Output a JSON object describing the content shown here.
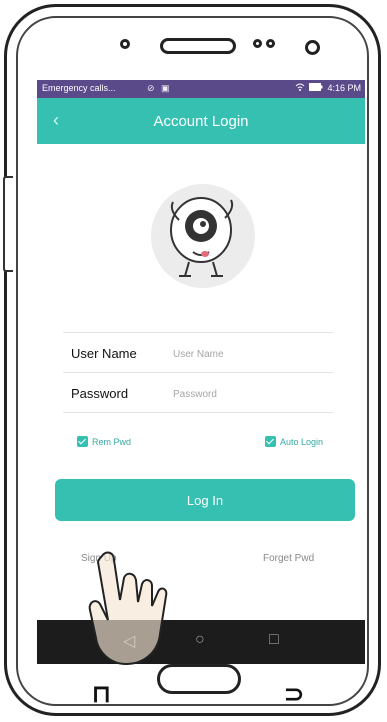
{
  "status_bar": {
    "carrier": "Emergency calls...",
    "time": "4:16 PM",
    "icons": [
      "location-icon",
      "wifi-icon",
      "battery-icon"
    ]
  },
  "title_bar": {
    "title": "Account Login",
    "back_icon": "‹"
  },
  "form": {
    "username_label": "User Name",
    "username_placeholder": "User Name",
    "password_label": "Password",
    "password_placeholder": "Password"
  },
  "options": {
    "remember_label": "Rem Pwd",
    "remember_checked": true,
    "auto_login_label": "Auto Login",
    "auto_login_checked": true
  },
  "login_button": "Log In",
  "links": {
    "sign_up": "Sign Up",
    "forget": "Forget Pwd"
  },
  "nav_bar": {
    "back": "◁",
    "home": "○",
    "recent": "□"
  },
  "colors": {
    "accent": "#36c0b2",
    "status_bar": "#5a4a8a",
    "nav_bar": "#1c1c1c"
  }
}
